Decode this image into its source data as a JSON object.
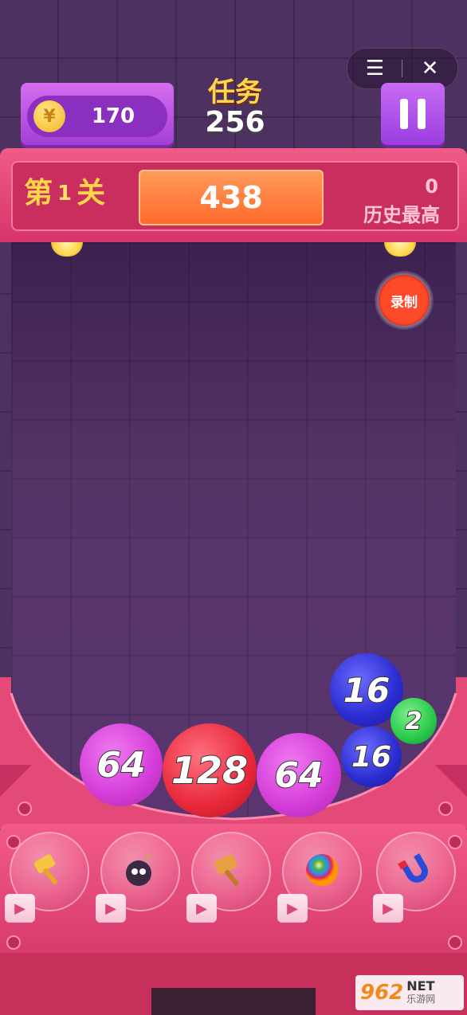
{
  "topbar": {
    "menu_icon": "☰",
    "close_icon": "✕"
  },
  "coins": {
    "symbol": "¥",
    "value": "170"
  },
  "task": {
    "title": "任务",
    "value": "256"
  },
  "level": {
    "prefix": "第",
    "number": "1",
    "suffix": "关",
    "score": "438",
    "best_value": "0",
    "best_label": "历史最高"
  },
  "record": {
    "label": "录制"
  },
  "balls": [
    {
      "value": "64"
    },
    {
      "value": "128"
    },
    {
      "value": "64"
    },
    {
      "value": "16"
    },
    {
      "value": "16"
    },
    {
      "value": "2"
    }
  ],
  "tools": [
    {
      "name": "hammer-icon"
    },
    {
      "name": "bomb-icon"
    },
    {
      "name": "mallet-icon"
    },
    {
      "name": "rainbow-ball-icon"
    },
    {
      "name": "magnet-icon"
    }
  ],
  "play_icon": "▶",
  "watermark": {
    "num": "962",
    "net": "NET",
    "cn": "乐游网"
  },
  "colors": {
    "header": "#e2416f",
    "score_box": "#ff7a36",
    "coin_panel": "#b84ce0",
    "ball_64": "#d43bd8",
    "ball_128": "#e8283a",
    "ball_16": "#2a2bd0",
    "ball_2": "#28c84a"
  }
}
